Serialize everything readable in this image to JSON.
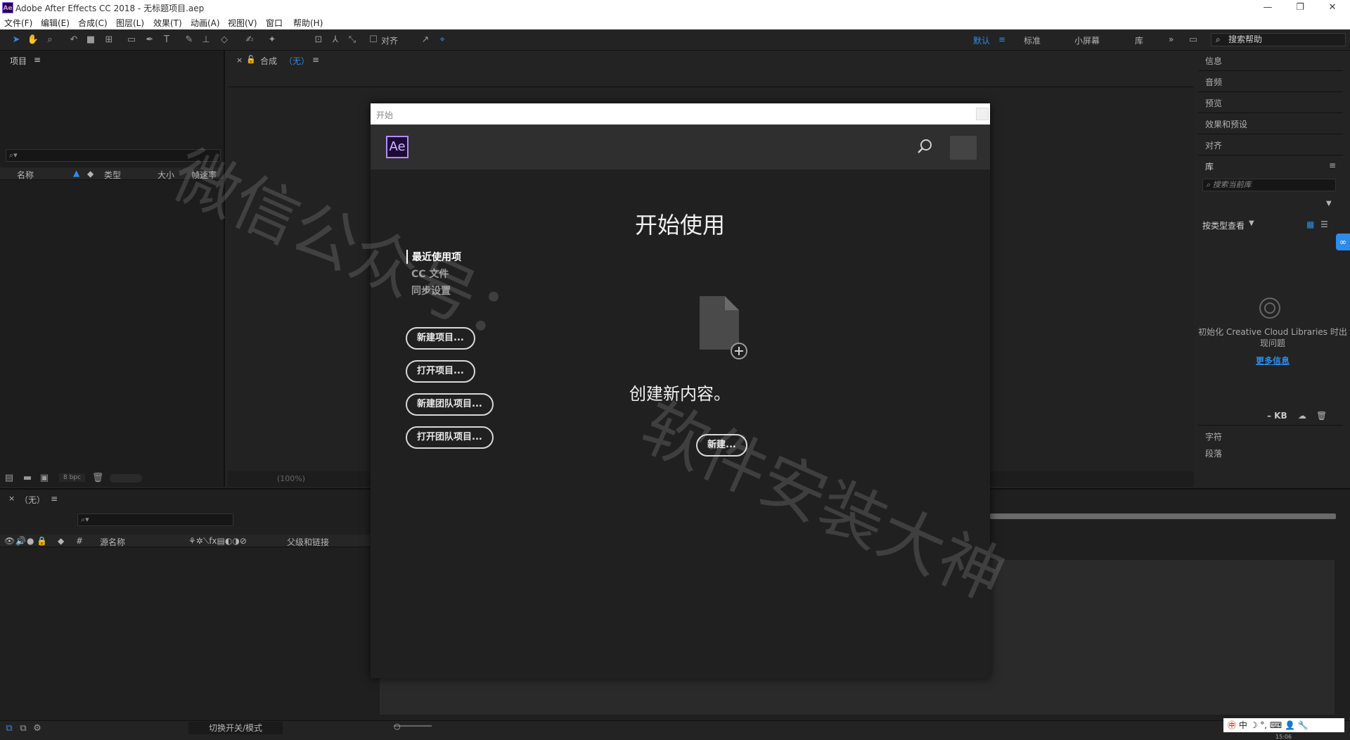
{
  "window": {
    "title": "Adobe After Effects CC 2018 - 无标题项目.aep",
    "app_icon_text": "Ae",
    "controls": {
      "minimize": "—",
      "maximize": "❐",
      "close": "✕"
    }
  },
  "menubar": [
    "文件(F)",
    "编辑(E)",
    "合成(C)",
    "图层(L)",
    "效果(T)",
    "动画(A)",
    "视图(V)",
    "窗口",
    "帮助(H)"
  ],
  "toolbar": {
    "snap_label": "对齐",
    "workspaces": [
      "默认",
      "标准",
      "小屏幕",
      "库"
    ],
    "active_workspace": "默认",
    "more_glyph": "»",
    "search_help": "搜索帮助"
  },
  "project_panel": {
    "title": "项目",
    "search_glyph": "⌕▾",
    "columns": [
      "名称",
      "类型",
      "大小",
      "帧速率"
    ],
    "bpc": "8 bpc"
  },
  "comp_panel": {
    "tab_label": "合成",
    "tab_value": "（无）",
    "zoom": "(100%)"
  },
  "right_panel": {
    "items": [
      "信息",
      "音频",
      "预览",
      "效果和预设",
      "对齐"
    ],
    "library_title": "库",
    "library_search_placeholder": "搜索当前库",
    "view_by": "按类型查看",
    "cc_message": "初始化 Creative Cloud Libraries 时出现问题",
    "more_info": "更多信息",
    "kb": "– KB",
    "bottom_items": [
      "字符",
      "段落"
    ]
  },
  "timeline_panel": {
    "tab_label": "（无）",
    "columns": [
      "#",
      "源名称",
      "父级和链接"
    ],
    "switch_mode": "切换开关/模式"
  },
  "start_dialog": {
    "title": "开始",
    "logo": "Ae",
    "heading": "开始使用",
    "nav": [
      "最近使用项",
      "CC 文件",
      "同步设置"
    ],
    "buttons": [
      "新建项目...",
      "打开项目...",
      "新建团队项目...",
      "打开团队项目..."
    ],
    "create_text": "创建新内容。",
    "new_button": "新建..."
  },
  "watermark": {
    "line1": "微信公众号：",
    "line2": "软件安装大神"
  },
  "taskbar": {
    "ime": [
      "中",
      "☽",
      "°,",
      "⌨",
      "👤",
      "🔧"
    ],
    "clock": "15:06"
  },
  "colors": {
    "accent": "#2d8ceb",
    "panel_bg": "#1d1d1d",
    "dialog_bg": "#202020",
    "ae_purple": "#b68cf7"
  }
}
